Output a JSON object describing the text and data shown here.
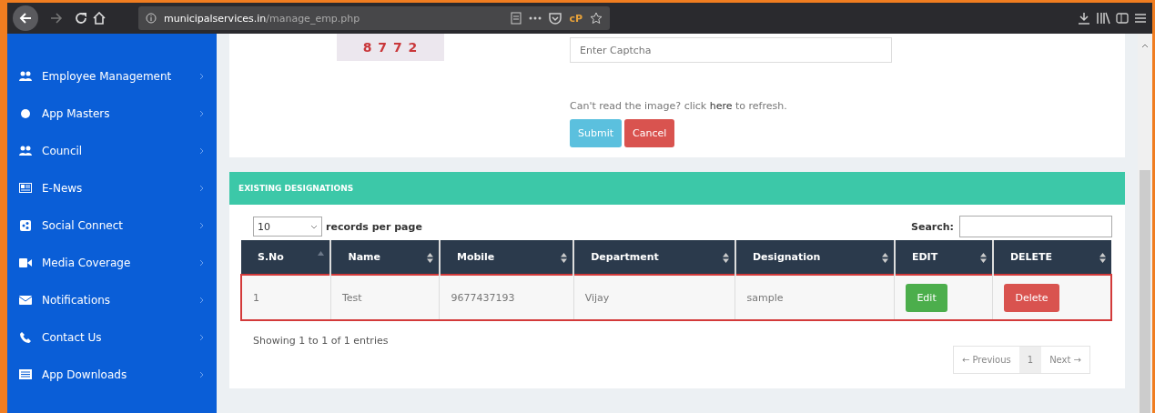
{
  "browser": {
    "url_host": "municipalservices.in",
    "url_path": "/manage_emp.php",
    "extension_label": "cP"
  },
  "sidebar": {
    "items": [
      {
        "label": "Employee Management"
      },
      {
        "label": "App Masters"
      },
      {
        "label": "Council"
      },
      {
        "label": "E-News"
      },
      {
        "label": "Social Connect"
      },
      {
        "label": "Media Coverage"
      },
      {
        "label": "Notifications"
      },
      {
        "label": "Contact Us"
      },
      {
        "label": "App Downloads"
      }
    ]
  },
  "captcha": {
    "code": "8 7 7 2",
    "placeholder": "Enter Captcha",
    "hint": "Can't read the image? click **here** to refresh.",
    "buttons": [
      {
        "label": "Submit",
        "kind": "primary"
      },
      {
        "label": "Cancel",
        "kind": "danger"
      }
    ]
  },
  "designations": {
    "title": "EXISTING DESIGNATIONS",
    "page_size": "10",
    "page_size_label": "records per page",
    "search_label": "Search:",
    "table": {
      "columns": [
        {
          "label": "S.No",
          "sorted": true
        },
        {
          "label": "Name",
          "sorted": false
        },
        {
          "label": "Mobile",
          "sorted": false
        },
        {
          "label": "Department",
          "sorted": false
        },
        {
          "label": "Designation",
          "sorted": false
        },
        {
          "label": "EDIT",
          "sorted": false
        },
        {
          "label": "DELETE",
          "sorted": false
        }
      ],
      "rows": [
        {
          "highlighted": true,
          "cells": [
            {
              "kind": "text",
              "text": "1"
            },
            {
              "kind": "text",
              "text": "Test"
            },
            {
              "kind": "text",
              "text": "9677437193"
            },
            {
              "kind": "text",
              "text": "Vijay"
            },
            {
              "kind": "text",
              "text": "sample"
            },
            {
              "kind": "edit",
              "text": "Edit"
            },
            {
              "kind": "delete",
              "text": "Delete"
            }
          ]
        }
      ]
    },
    "info": "Showing 1 to 1 of 1 entries",
    "pagination": [
      {
        "label": "← Previous",
        "selected": false
      },
      {
        "label": "1",
        "selected": true
      },
      {
        "label": "Next →",
        "selected": false
      }
    ]
  }
}
